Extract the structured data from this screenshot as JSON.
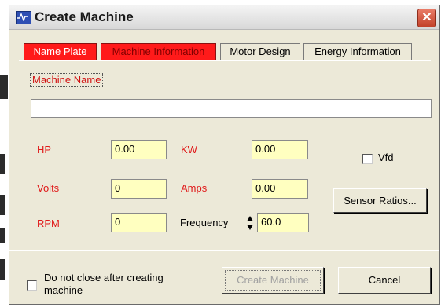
{
  "dialog": {
    "title": "Create Machine",
    "close_symbol": "✕"
  },
  "tabs": [
    {
      "label": "Name Plate",
      "state": "active"
    },
    {
      "label": "Machine Information",
      "state": "highlighted"
    },
    {
      "label": "Motor Design",
      "state": "normal"
    },
    {
      "label": "Energy Information",
      "state": "normal"
    }
  ],
  "form": {
    "machine_name_label": "Machine Name",
    "machine_name_value": "",
    "hp_label": "HP",
    "hp_value": "0.00",
    "kw_label": "KW",
    "kw_value": "0.00",
    "volts_label": "Volts",
    "volts_value": "0",
    "amps_label": "Amps",
    "amps_value": "0.00",
    "rpm_label": "RPM",
    "rpm_value": "0",
    "frequency_label": "Frequency",
    "frequency_value": "60.0",
    "vfd_label": "Vfd",
    "vfd_checked": false,
    "sensor_ratios_label": "Sensor Ratios..."
  },
  "footer": {
    "do_not_close_label_line1": "Do not close after creating",
    "do_not_close_label_line2": "machine",
    "do_not_close_checked": false,
    "create_machine_label": "Create Machine",
    "cancel_label": "Cancel"
  },
  "colors": {
    "active_tab": "#ff1a1a",
    "field_background": "#ffffc0",
    "label_red": "#e01818",
    "dialog_background": "#ece9d8"
  }
}
